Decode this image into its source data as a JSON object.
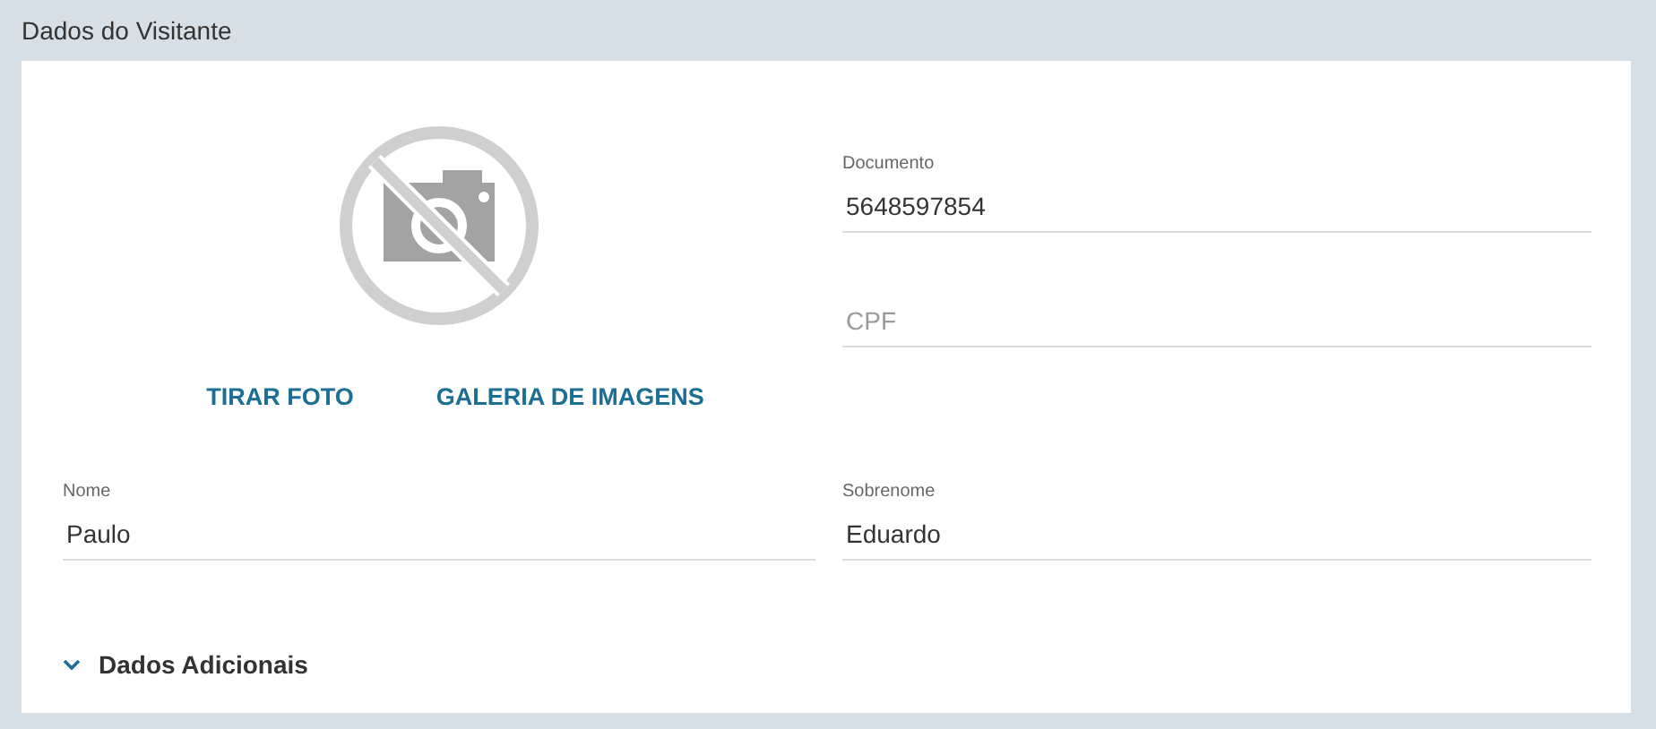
{
  "page_title": "Dados do Visitante",
  "photo_actions": [
    {
      "label": "TIRAR FOTO"
    },
    {
      "label": "GALERIA DE IMAGENS"
    }
  ],
  "fields_top": [
    {
      "label": "Documento",
      "value": "5648597854"
    },
    {
      "placeholder": "CPF"
    }
  ],
  "fields_name": [
    {
      "label": "Nome",
      "value": "Paulo"
    },
    {
      "label": "Sobrenome",
      "value": "Eduardo"
    }
  ],
  "section": {
    "label": "Dados Adicionais",
    "expanded": false
  }
}
